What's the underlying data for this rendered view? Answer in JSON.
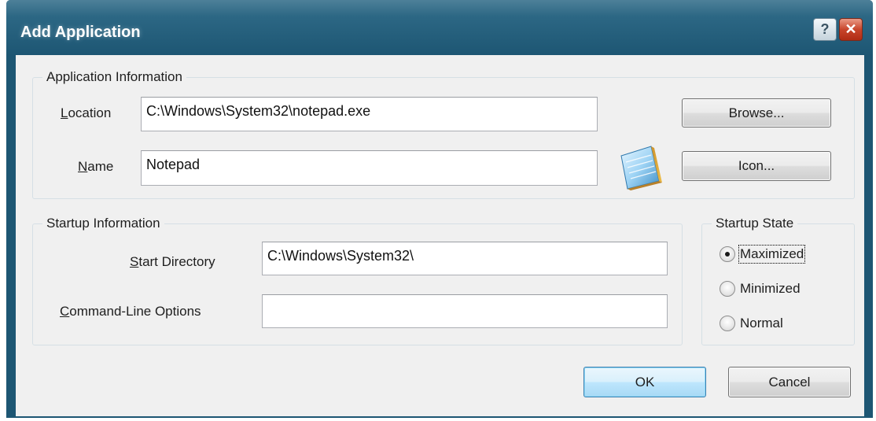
{
  "window": {
    "title": "Add Application",
    "help_glyph": "?",
    "close_glyph": "✕"
  },
  "app_info": {
    "legend": "Application Information",
    "location": {
      "label_u": "L",
      "label_rest": "ocation",
      "value": "C:\\Windows\\System32\\notepad.exe"
    },
    "name": {
      "label_u": "N",
      "label_rest": "ame",
      "value": "Notepad"
    },
    "browse_u": "B",
    "browse_rest": "rowse...",
    "icon_u": "I",
    "icon_rest": "con...",
    "app_icon": "notepad-icon"
  },
  "startup_info": {
    "legend": "Startup Information",
    "start_dir": {
      "label_u": "S",
      "label_rest": "tart Directory",
      "value": "C:\\Windows\\System32\\"
    },
    "cmd_opts": {
      "label_u": "C",
      "label_rest": "ommand-Line Options",
      "value": ""
    }
  },
  "startup_state": {
    "legend": "Startup State",
    "options": [
      {
        "u": "M",
        "rest": "aximized",
        "selected": true
      },
      {
        "pre": "M",
        "u": "i",
        "rest": "nimized",
        "selected": false
      },
      {
        "u": "N",
        "rest": "ormal",
        "selected": false
      }
    ]
  },
  "buttons": {
    "ok": "OK",
    "cancel": "Cancel"
  }
}
